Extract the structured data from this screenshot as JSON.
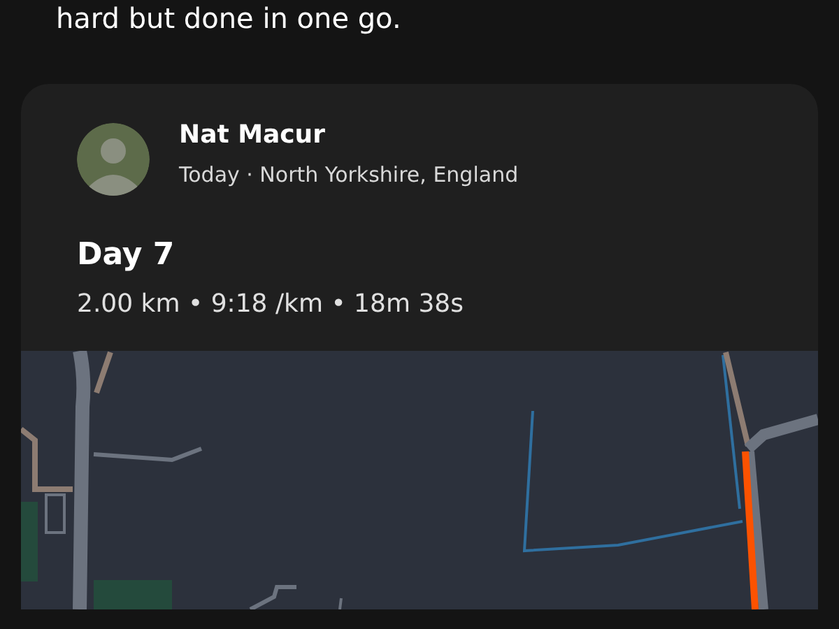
{
  "intro_text": "hard but done in one go.",
  "activity": {
    "athlete": "Nat Macur",
    "meta": "Today · North Yorkshire, England",
    "title": "Day 7",
    "stats": "2.00 km • 9:18 /km • 18m 38s"
  }
}
